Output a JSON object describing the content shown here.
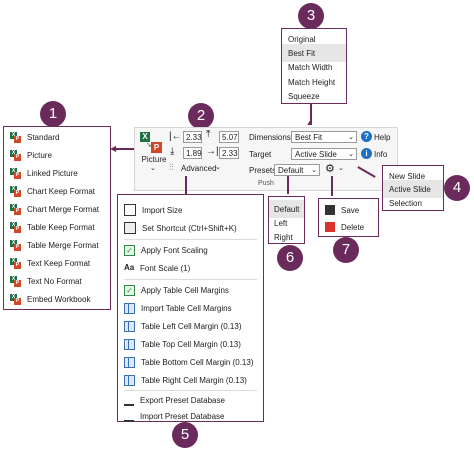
{
  "badges": {
    "b1": "1",
    "b2": "2",
    "b3": "3",
    "b4": "4",
    "b5": "5",
    "b6": "6",
    "b7": "7"
  },
  "menu1": {
    "items": [
      "Standard",
      "Picture",
      "Linked Picture",
      "Chart Keep Format",
      "Chart Merge Format",
      "Table Keep Format",
      "Table Merge Format",
      "Text Keep Format",
      "Text No Format",
      "Embed Workbook"
    ]
  },
  "ribbon": {
    "picture_label": "Picture",
    "advanced_label": "Advanced",
    "left_margin": "2.33",
    "top_margin": "5.07",
    "bottom_margin": "1.89",
    "right_margin": "2.33",
    "dimensions_label": "Dimensions",
    "dimensions_value": "Best Fit",
    "target_label": "Target",
    "target_value": "Active Slide",
    "presets_label": "Presets",
    "presets_value": "Default",
    "help_label": "Help",
    "info_label": "Info",
    "group_label": "Push",
    "icons": [
      "excel-icon",
      "powerpoint-icon",
      "margin-left-icon",
      "margin-top-icon",
      "margin-bottom-icon",
      "margin-right-icon",
      "gear-icon",
      "help-icon",
      "info-icon"
    ]
  },
  "menu3": {
    "items": [
      "Original",
      "Best Fit",
      "Match Width",
      "Match Height",
      "Squeeze"
    ]
  },
  "menu4": {
    "items": [
      "New Slide",
      "Active Slide",
      "Selection"
    ]
  },
  "menu5": {
    "items": [
      "Import Size",
      "Set Shortcut (Ctrl+Shift+K)",
      "Apply Font Scaling",
      "Font Scale (1)",
      "Apply Table Cell Margins",
      "Import Table Cell Margins",
      "Table Left Cell Margin (0.13)",
      "Table Top Cell Margin (0.13)",
      "Table Bottom Cell Margin (0.13)",
      "Table Right Cell Margin (0.13)",
      "Export Preset Database",
      "Import Preset Database"
    ]
  },
  "menu6": {
    "items": [
      "Default",
      "Left",
      "Right"
    ]
  },
  "menu7": {
    "items": [
      "Save",
      "Delete"
    ]
  },
  "colors": {
    "accent": "#6b2a5c",
    "excel": "#1e7145",
    "ppt": "#d24726",
    "info": "#1f6fc5"
  }
}
